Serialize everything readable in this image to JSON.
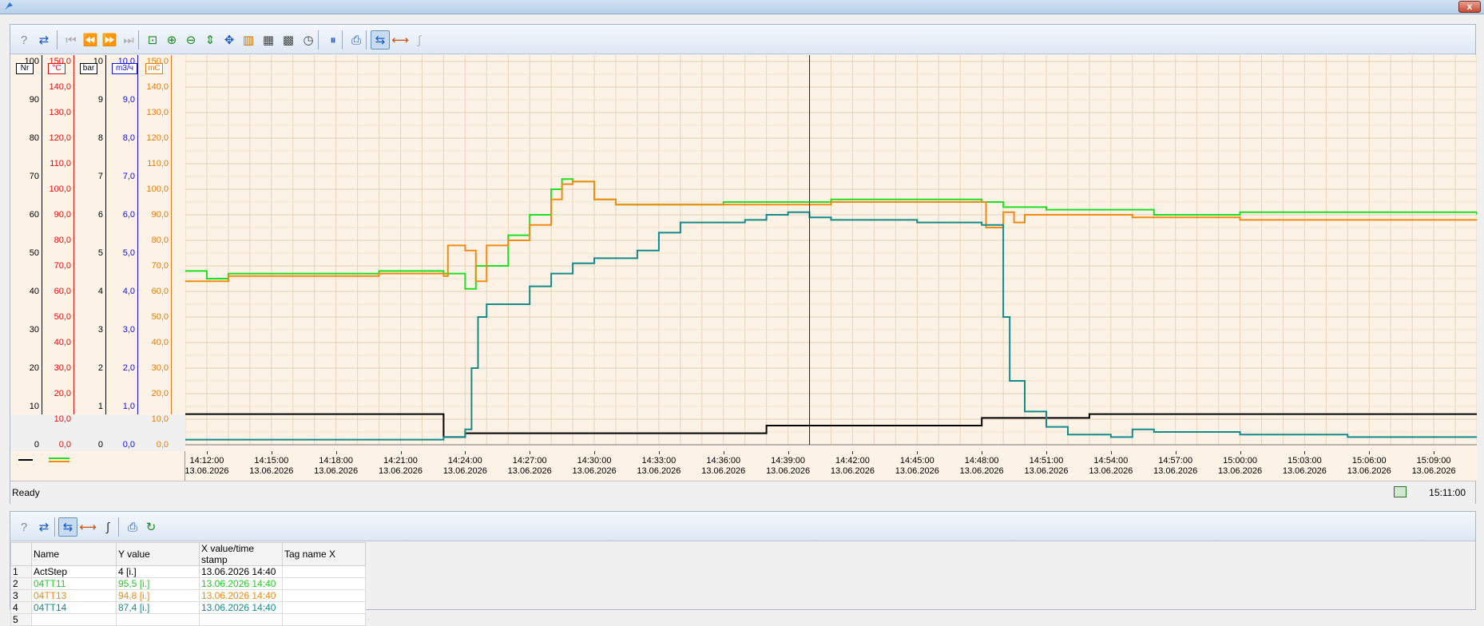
{
  "window": {
    "close_label": "x"
  },
  "toolbar_top": {
    "icons": [
      "help-icon",
      "export-icon",
      "first-icon",
      "prev-icon",
      "next-icon",
      "last-icon",
      "zoom-area-icon",
      "zoom-in-icon",
      "zoom-out-icon",
      "zoom-y-icon",
      "pan-icon",
      "scale-icon",
      "grid-icon",
      "grid-time-icon",
      "clock-icon",
      "pause-icon",
      "print-icon",
      "ruler-icon",
      "select-range-icon",
      "integral-icon"
    ]
  },
  "y_axes": [
    {
      "unit": "Nr",
      "color": "#000000",
      "labels": [
        "100",
        "90",
        "80",
        "70",
        "60",
        "50",
        "40",
        "30",
        "20",
        "10",
        "0"
      ]
    },
    {
      "unit": "°C",
      "color": "#e01010",
      "labels": [
        "150,0",
        "140,0",
        "130,0",
        "120,0",
        "110,0",
        "100,0",
        "90,0",
        "80,0",
        "70,0",
        "60,0",
        "50,0",
        "40,0",
        "30,0",
        "20,0",
        "10,0",
        "0,0"
      ]
    },
    {
      "unit": "bar",
      "color": "#000000",
      "labels": [
        "10",
        "9",
        "8",
        "7",
        "6",
        "5",
        "4",
        "3",
        "2",
        "1",
        "0"
      ]
    },
    {
      "unit": "m3/ч",
      "color": "#1010e0",
      "labels": [
        "10,0",
        "9,0",
        "8,0",
        "7,0",
        "6,0",
        "5,0",
        "4,0",
        "3,0",
        "2,0",
        "1,0",
        "0,0"
      ]
    },
    {
      "unit": "mC",
      "color": "#e08010",
      "labels": [
        "150,0",
        "140,0",
        "130,0",
        "120,0",
        "110,0",
        "100,0",
        "90,0",
        "80,0",
        "70,0",
        "60,0",
        "50,0",
        "40,0",
        "30,0",
        "20,0",
        "10,0",
        "0,0"
      ]
    }
  ],
  "x_axis": {
    "times": [
      "14:12:00",
      "14:15:00",
      "14:18:00",
      "14:21:00",
      "14:24:00",
      "14:27:00",
      "14:30:00",
      "14:33:00",
      "14:36:00",
      "14:39:00",
      "14:42:00",
      "14:45:00",
      "14:48:00",
      "14:51:00",
      "14:54:00",
      "14:57:00",
      "15:00:00",
      "15:03:00",
      "15:06:00",
      "15:09:00"
    ],
    "date": "13.06.2026"
  },
  "chart_data": {
    "type": "line",
    "x_range": [
      "14:11:00",
      "15:11:00"
    ],
    "y_axis_primary": {
      "unit": "°C",
      "ylim": [
        0,
        150
      ]
    },
    "cursor_time": "14:40",
    "series": [
      {
        "name": "ActStep",
        "color": "#000000",
        "axis": "Nr",
        "points": [
          [
            "14:11",
            8
          ],
          [
            "14:23",
            8
          ],
          [
            "14:23",
            2
          ],
          [
            "14:24",
            2
          ],
          [
            "14:24",
            3
          ],
          [
            "14:38",
            3
          ],
          [
            "14:38",
            5
          ],
          [
            "14:48",
            5
          ],
          [
            "14:48",
            7
          ],
          [
            "14:53",
            7
          ],
          [
            "14:53",
            8
          ],
          [
            "15:11",
            8
          ]
        ]
      },
      {
        "name": "04TT11",
        "color": "#22dd22",
        "axis": "°C",
        "points": [
          [
            "14:11",
            68
          ],
          [
            "14:12",
            65
          ],
          [
            "14:13",
            67
          ],
          [
            "14:18",
            67
          ],
          [
            "14:20",
            68
          ],
          [
            "14:23",
            67
          ],
          [
            "14:24",
            61
          ],
          [
            "14:24.5",
            70
          ],
          [
            "14:26",
            82
          ],
          [
            "14:27",
            90
          ],
          [
            "14:28",
            100
          ],
          [
            "14:28.5",
            104
          ],
          [
            "14:29",
            103
          ],
          [
            "14:30",
            96
          ],
          [
            "14:31",
            94
          ],
          [
            "14:36",
            95
          ],
          [
            "14:41",
            96
          ],
          [
            "14:48",
            95
          ],
          [
            "14:49",
            93
          ],
          [
            "14:51",
            92
          ],
          [
            "14:56",
            90
          ],
          [
            "15:00",
            91
          ],
          [
            "15:05",
            91
          ],
          [
            "15:11",
            90
          ]
        ]
      },
      {
        "name": "04TT13",
        "color": "#f08a10",
        "axis": "°C",
        "points": [
          [
            "14:11",
            64
          ],
          [
            "14:13",
            66
          ],
          [
            "14:16",
            66
          ],
          [
            "14:20",
            67
          ],
          [
            "14:23",
            66
          ],
          [
            "14:23.2",
            78
          ],
          [
            "14:24",
            76
          ],
          [
            "14:24.5",
            64
          ],
          [
            "14:25",
            78
          ],
          [
            "14:26",
            80
          ],
          [
            "14:27",
            86
          ],
          [
            "14:28",
            96
          ],
          [
            "14:28.5",
            102
          ],
          [
            "14:29",
            103
          ],
          [
            "14:30",
            96
          ],
          [
            "14:31",
            94
          ],
          [
            "14:36",
            94
          ],
          [
            "14:41",
            95
          ],
          [
            "14:48",
            95
          ],
          [
            "14:48.2",
            85
          ],
          [
            "14:49",
            91
          ],
          [
            "14:49.5",
            87
          ],
          [
            "14:50",
            90
          ],
          [
            "14:55",
            89
          ],
          [
            "15:00",
            88
          ],
          [
            "15:11",
            88
          ]
        ]
      },
      {
        "name": "04TT14",
        "color": "#158a8a",
        "axis": "°C",
        "points": [
          [
            "14:11",
            2
          ],
          [
            "14:22",
            2
          ],
          [
            "14:23",
            3
          ],
          [
            "14:24",
            6
          ],
          [
            "14:24.3",
            30
          ],
          [
            "14:24.6",
            50
          ],
          [
            "14:25",
            55
          ],
          [
            "14:27",
            62
          ],
          [
            "14:28",
            67
          ],
          [
            "14:29",
            71
          ],
          [
            "14:30",
            73
          ],
          [
            "14:31",
            73
          ],
          [
            "14:32",
            76
          ],
          [
            "14:33",
            83
          ],
          [
            "14:34",
            87
          ],
          [
            "14:36",
            87
          ],
          [
            "14:37",
            88
          ],
          [
            "14:38",
            90
          ],
          [
            "14:39",
            91
          ],
          [
            "14:40",
            89
          ],
          [
            "14:41",
            88
          ],
          [
            "14:45",
            87
          ],
          [
            "14:48",
            86
          ],
          [
            "14:48.5",
            86
          ],
          [
            "14:49",
            50
          ],
          [
            "14:49.3",
            25
          ],
          [
            "14:50",
            13
          ],
          [
            "14:51",
            7
          ],
          [
            "14:52",
            4
          ],
          [
            "14:54",
            3
          ],
          [
            "14:55",
            6
          ],
          [
            "14:56",
            5
          ],
          [
            "15:00",
            4
          ],
          [
            "15:05",
            3
          ],
          [
            "15:11",
            3
          ]
        ]
      }
    ]
  },
  "status": {
    "text": "Ready",
    "time": "15:11:00"
  },
  "toolbar_bottom": {
    "icons": [
      "help-icon",
      "export-icon",
      "ruler-icon",
      "select-range-icon",
      "integral-icon",
      "print-icon",
      "refresh-icon"
    ]
  },
  "table": {
    "columns": [
      "Name",
      "Y value",
      "X value/time stamp",
      "Tag name X"
    ],
    "rows": [
      {
        "no": "1",
        "name": "ActStep",
        "y": "4 [i.]",
        "x": "13.06.2026 14:40",
        "tag": "",
        "color": "#000000"
      },
      {
        "no": "2",
        "name": "04TT11",
        "y": "95,5 [i.]",
        "x": "13.06.2026 14:40",
        "tag": "",
        "color": "#22cc22"
      },
      {
        "no": "3",
        "name": "04TT13",
        "y": "94,8 [i.]",
        "x": "13.06.2026 14:40",
        "tag": "",
        "color": "#f08a10"
      },
      {
        "no": "4",
        "name": "04TT14",
        "y": "87,4 [i.]",
        "x": "13.06.2026 14:40",
        "tag": "",
        "color": "#158a8a"
      },
      {
        "no": "5",
        "name": "",
        "y": "",
        "x": "",
        "tag": "",
        "color": "#000000"
      }
    ]
  }
}
